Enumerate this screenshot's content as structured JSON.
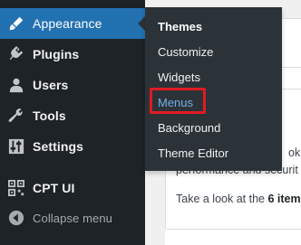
{
  "sidebar": {
    "items": [
      {
        "label": "Appearance",
        "icon": "paintbrush-icon",
        "current": true
      },
      {
        "label": "Plugins",
        "icon": "plug-icon"
      },
      {
        "label": "Users",
        "icon": "user-icon"
      },
      {
        "label": "Tools",
        "icon": "wrench-icon"
      },
      {
        "label": "Settings",
        "icon": "sliders-icon"
      },
      {
        "label": "CPT UI",
        "icon": "qr-grid-icon"
      },
      {
        "label": "Collapse menu",
        "icon": "collapse-arrow-icon"
      }
    ]
  },
  "submenu": {
    "items": [
      {
        "label": "Themes"
      },
      {
        "label": "Customize"
      },
      {
        "label": "Widgets"
      },
      {
        "label": "Menus",
        "highlighted": true
      },
      {
        "label": "Background"
      },
      {
        "label": "Theme Editor"
      }
    ]
  },
  "content": {
    "line1": "performance and securit",
    "line1_prefix": "ok",
    "line2_before": "Take a look at the ",
    "line2_bold": "6 item"
  },
  "colors": {
    "sidebar_bg": "#1d2327",
    "submenu_bg": "#2c3338",
    "current_bg": "#2271b1",
    "active_link": "#72aee6",
    "highlight_border": "#e01b24"
  }
}
